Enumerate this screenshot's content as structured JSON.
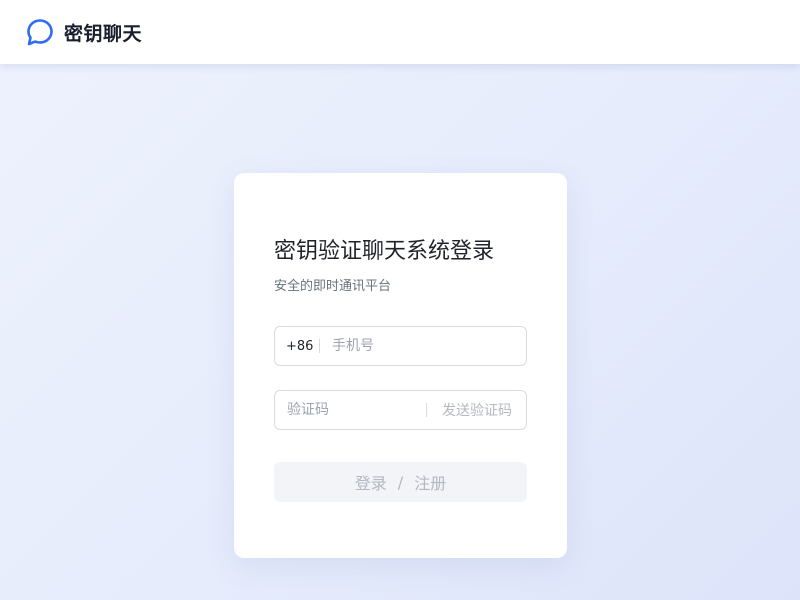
{
  "header": {
    "app_name": "密钥聊天",
    "logo_icon": "chat-bubble-icon",
    "accent_color": "#2f6bf2"
  },
  "login": {
    "title": "密钥验证聊天系统登录",
    "subtitle": "安全的即时通讯平台",
    "phone": {
      "country_code": "+86",
      "placeholder": "手机号",
      "value": ""
    },
    "code": {
      "placeholder": "验证码",
      "value": "",
      "send_label": "发送验证码"
    },
    "submit": {
      "login_label": "登录",
      "separator": "/",
      "register_label": "注册"
    }
  }
}
